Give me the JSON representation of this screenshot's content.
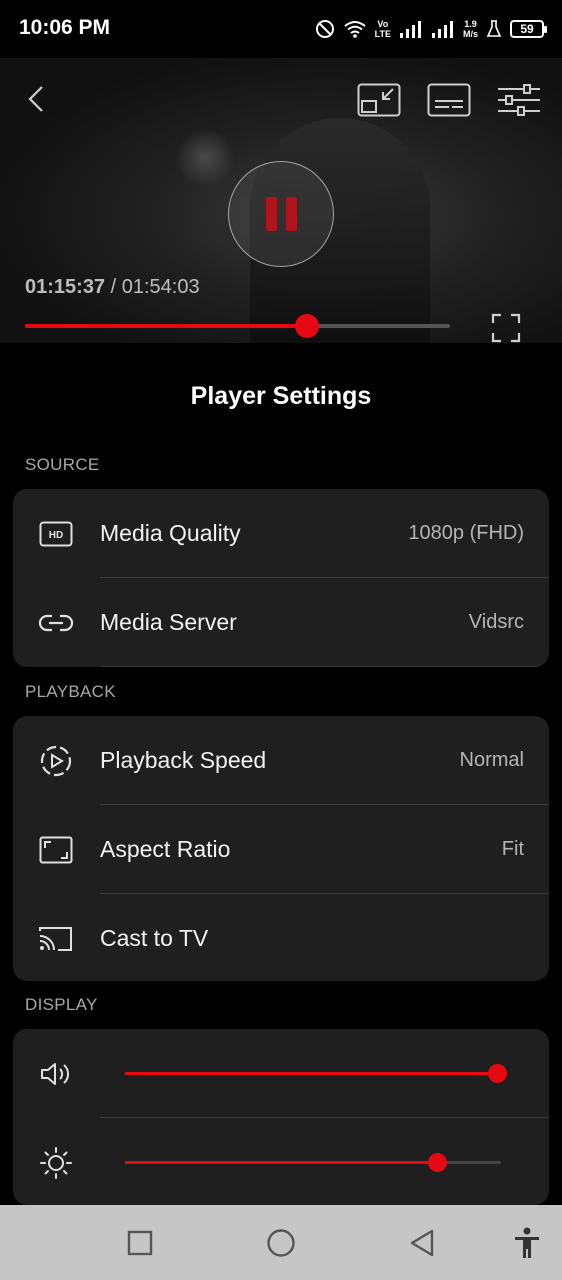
{
  "status_bar": {
    "time": "10:06 PM",
    "net_line1": "Vo",
    "net_line2": "LTE",
    "speed_line1": "1.9",
    "speed_line2": "M/s",
    "battery": "59"
  },
  "player": {
    "current_time": "01:15:37",
    "separator": " / ",
    "duration": "01:54:03",
    "progress": 0.663
  },
  "title": "Player Settings",
  "sections": {
    "source": {
      "label": "SOURCE",
      "rows": [
        {
          "label": "Media Quality",
          "value": "1080p (FHD)",
          "icon": "hd-icon"
        },
        {
          "label": "Media Server",
          "value": "Vidsrc",
          "icon": "link-icon"
        }
      ]
    },
    "playback": {
      "label": "PLAYBACK",
      "rows": [
        {
          "label": "Playback Speed",
          "value": "Normal",
          "icon": "playback-speed-icon"
        },
        {
          "label": "Aspect Ratio",
          "value": "Fit",
          "icon": "aspect-ratio-icon"
        },
        {
          "label": "Cast to TV",
          "value": "",
          "icon": "cast-icon"
        }
      ]
    },
    "display": {
      "label": "DISPLAY",
      "volume_level": 0.99,
      "brightness_level": 0.83
    }
  },
  "colors": {
    "accent": "#e50914",
    "card": "#1f1f1f",
    "background": "#000000"
  }
}
